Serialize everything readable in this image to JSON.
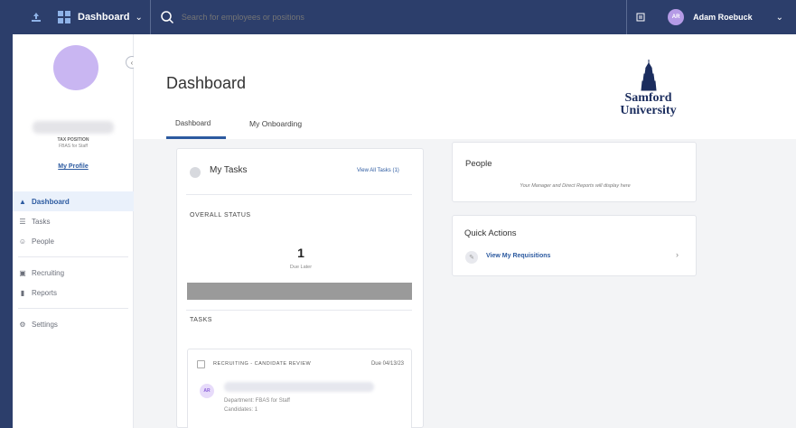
{
  "topbar": {
    "app_title": "Dashboard",
    "search_placeholder": "Search for employees or positions",
    "user_initials": "AR",
    "user_name": "Adam Roebuck"
  },
  "sidebar": {
    "position": "TAX POSITION",
    "department": "FBAS for Staff",
    "profile_link": "My Profile",
    "nav": [
      {
        "label": "Dashboard",
        "icon": "home-icon",
        "active": true
      },
      {
        "label": "Tasks",
        "icon": "tasks-icon"
      },
      {
        "label": "People",
        "icon": "people-icon"
      },
      {
        "label": "Recruiting",
        "icon": "recruiting-icon"
      },
      {
        "label": "Reports",
        "icon": "reports-icon"
      },
      {
        "label": "Settings",
        "icon": "settings-icon"
      }
    ]
  },
  "header": {
    "title": "Dashboard",
    "logo_line1": "Samford",
    "logo_line2": "University",
    "tabs": [
      {
        "label": "Dashboard",
        "active": true
      },
      {
        "label": "My Onboarding"
      }
    ]
  },
  "tasks_card": {
    "title": "My Tasks",
    "view_all": "View All Tasks (1)",
    "overall_status": "OVERALL STATUS",
    "due_count": "1",
    "due_label": "Due Later",
    "tasks_label": "TASKS",
    "task": {
      "name": "RECRUITING - CANDIDATE REVIEW",
      "due": "Due 04/13/23",
      "avatar": "AR",
      "department": "Department: FBAS for Staff",
      "candidates": "Candidates: 1"
    }
  },
  "people_card": {
    "title": "People",
    "description": "Your Manager and Direct Reports will display here"
  },
  "quick_actions": {
    "title": "Quick Actions",
    "link": "View My Requisitions"
  },
  "colors": {
    "topbar": "#2c3e6b",
    "accent": "#2c5aa0",
    "avatar": "#c9b6f2"
  }
}
